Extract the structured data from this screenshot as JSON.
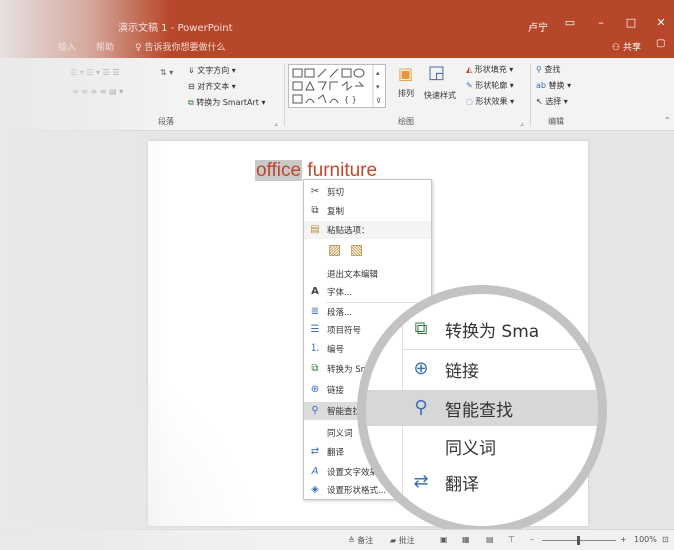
{
  "window": {
    "title": "演示文稿 1 - PowerPoint",
    "user": "卢宁",
    "tabs": [
      "插入",
      "帮助"
    ],
    "tell_me": "告诉我你想要做什么",
    "share": "共享"
  },
  "ribbon": {
    "paragraph": {
      "label": "段落",
      "text_direction": "文字方向",
      "align_text": "对齐文本",
      "convert_smartart": "转换为 SmartArt"
    },
    "drawing": {
      "label": "绘图",
      "arrange": "排列",
      "quick_styles": "快速样式",
      "shape_fill": "形状填充",
      "shape_outline": "形状轮廓",
      "shape_effects": "形状效果"
    },
    "editing": {
      "label": "编辑",
      "find": "查找",
      "replace": "替换",
      "select": "选择"
    }
  },
  "slide": {
    "text_selected": "office",
    "text_rest": "furniture"
  },
  "context_menu": {
    "items": [
      {
        "icon": "scissors-icon",
        "label": "剪切"
      },
      {
        "icon": "copy-icon",
        "label": "复制"
      },
      {
        "icon": "paste-icon",
        "label": "粘贴选项："
      },
      {
        "icon": "",
        "label": "退出文本编辑"
      },
      {
        "icon": "font-icon",
        "label": "字体..."
      },
      {
        "icon": "paragraph-icon",
        "label": "段落..."
      },
      {
        "icon": "bullets-icon",
        "label": "项目符号"
      },
      {
        "icon": "numbering-icon",
        "label": "编号"
      },
      {
        "icon": "smartart-icon",
        "label": "转换为 SmartArt"
      },
      {
        "icon": "link-icon",
        "label": "链接"
      },
      {
        "icon": "smart-lookup-icon",
        "label": "智能查找"
      },
      {
        "icon": "",
        "label": "同义词"
      },
      {
        "icon": "translate-icon",
        "label": "翻译"
      },
      {
        "icon": "text-effects-icon",
        "label": "设置文字效果格式..."
      },
      {
        "icon": "shape-format-icon",
        "label": "设置形状格式..."
      }
    ],
    "highlighted": "智能查找"
  },
  "magnifier": {
    "items": [
      {
        "icon": "smartart-icon",
        "label": "转换为 Sma"
      },
      {
        "icon": "link-icon",
        "label": "链接"
      },
      {
        "icon": "smart-lookup-icon",
        "label": "智能查找"
      },
      {
        "icon": "",
        "label": "同义词"
      },
      {
        "icon": "translate-icon",
        "label": "翻译"
      }
    ]
  },
  "status_bar": {
    "notes": "备注",
    "comments": "批注",
    "zoom": "100%"
  },
  "colors": {
    "title_bar": "#b7472a",
    "accent_text": "#c0472c",
    "highlight": "#dcdcdc"
  }
}
